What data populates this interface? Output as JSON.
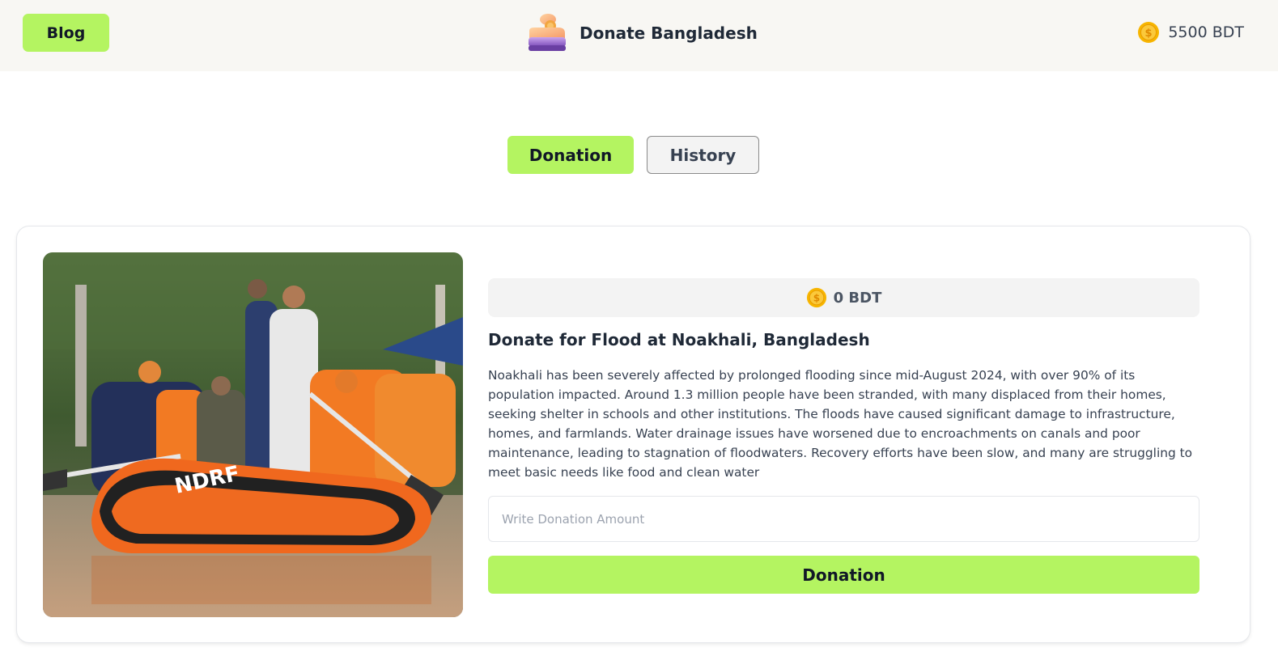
{
  "header": {
    "blog_label": "Blog",
    "brand_title": "Donate Bangladesh",
    "balance": "5500 BDT"
  },
  "tabs": {
    "donation_label": "Donation",
    "history_label": "History"
  },
  "card": {
    "collected_amount": "0 BDT",
    "title": "Donate for Flood at Noakhali, Bangladesh",
    "description": "Noakhali has been severely affected by prolonged flooding since mid-August 2024, with over 90% of its population impacted. Around 1.3 million people have been stranded, with many displaced from their homes, seeking shelter in schools and other institutions. The floods have caused significant damage to infrastructure, homes, and farmlands. Water drainage issues have worsened due to encroachments on canals and poor maintenance, leading to stagnation of floodwaters. Recovery efforts have been slow, and many are struggling to meet basic needs like food and clean water",
    "input_placeholder": "Write Donation Amount",
    "submit_label": "Donation"
  },
  "icons": {
    "logo": "donation-hand-icon",
    "coin": "gold-coin-icon"
  },
  "colors": {
    "accent": "#b4f461",
    "topbar_bg": "#f8f7f3",
    "coin": "#f7b500"
  }
}
